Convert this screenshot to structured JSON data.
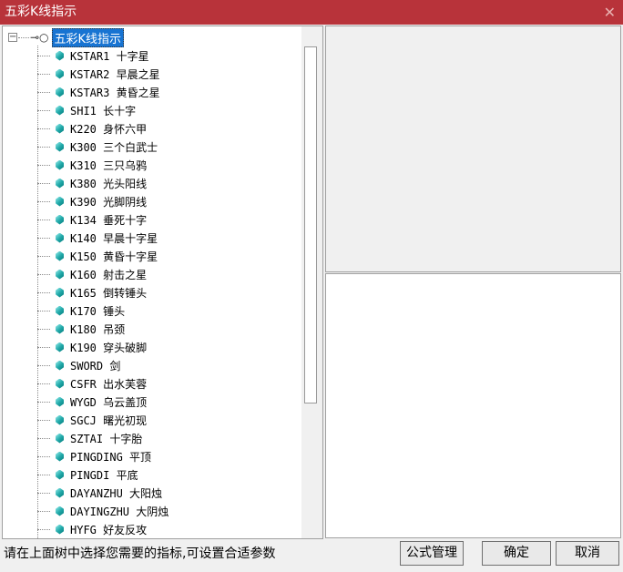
{
  "window": {
    "title": "五彩K线指示",
    "close_icon": "close-icon"
  },
  "tree": {
    "root_label": "五彩K线指示",
    "items": [
      "KSTAR1 十字星",
      "KSTAR2 早晨之星",
      "KSTAR3 黄昏之星",
      "SHI1 长十字",
      "K220 身怀六甲",
      "K300 三个白武士",
      "K310 三只乌鸦",
      "K380 光头阳线",
      "K390 光脚阴线",
      "K134 垂死十字",
      "K140 早晨十字星",
      "K150 黄昏十字星",
      "K160 射击之星",
      "K165 倒转锤头",
      "K170 锤头",
      "K180 吊颈",
      "K190 穿头破脚",
      "SWORD 剑",
      "CSFR 出水芙蓉",
      "WYGD 乌云盖顶",
      "SGCJ 曙光初现",
      "SZTAI 十字胎",
      "PINGDING 平顶",
      "PINGDI 平底",
      "DAYANZHU 大阳烛",
      "DAYINGZHU 大阴烛",
      "HYFG 好友反攻"
    ]
  },
  "status": "请在上面树中选择您需要的指标,可设置合适参数",
  "buttons": {
    "manage": "公式管理",
    "ok": "确定",
    "cancel": "取消"
  }
}
